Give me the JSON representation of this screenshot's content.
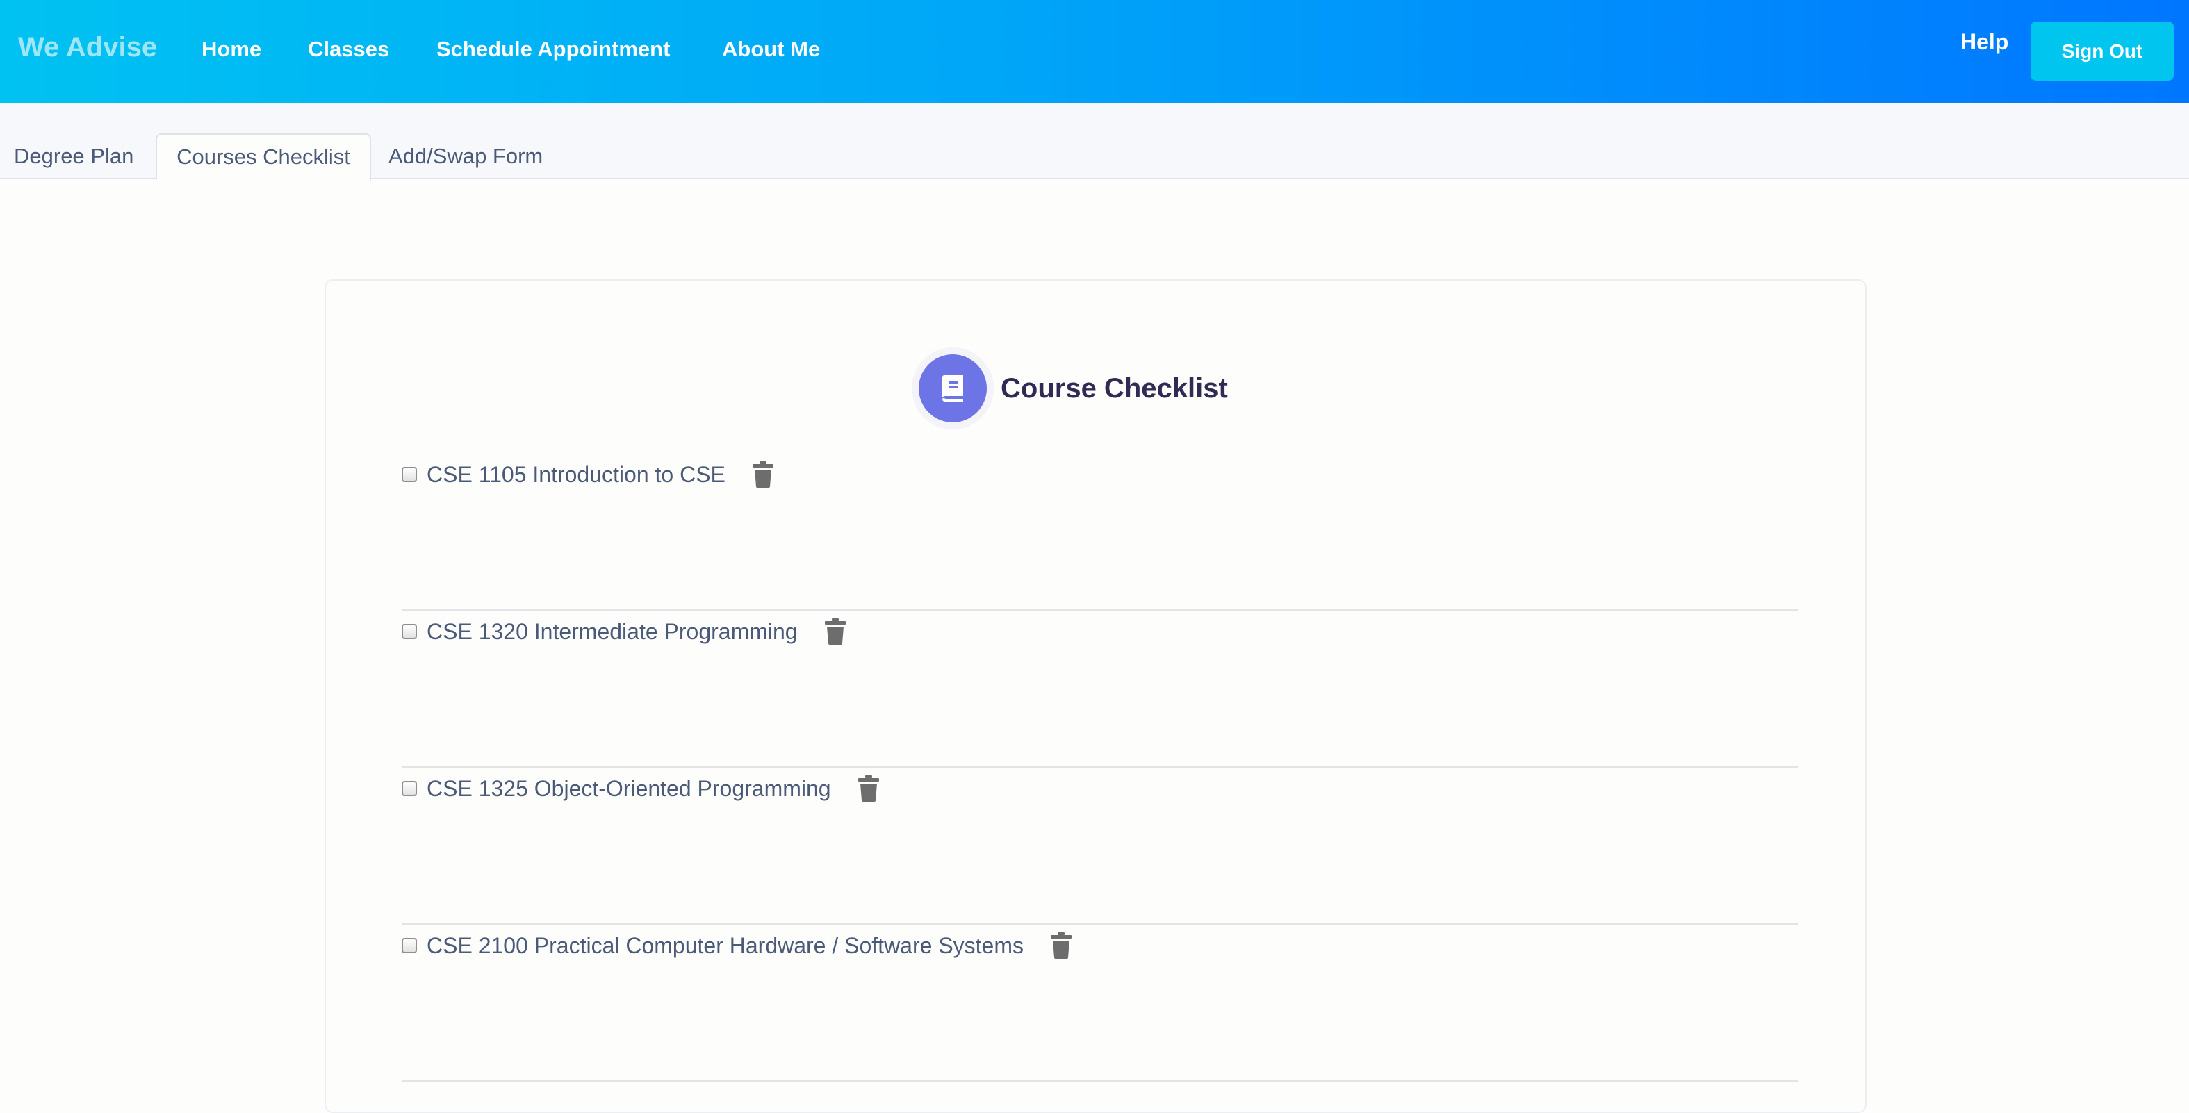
{
  "header": {
    "brand": "We Advise",
    "nav": {
      "home": "Home",
      "classes": "Classes",
      "schedule": "Schedule Appointment",
      "about": "About Me"
    },
    "help": "Help",
    "sign_out": "Sign Out"
  },
  "tabs": {
    "degree_plan": "Degree Plan",
    "courses_checklist": "Courses Checklist",
    "add_swap": "Add/Swap Form",
    "active": "Courses Checklist"
  },
  "checklist": {
    "title": "Course Checklist",
    "icon": "book-icon",
    "courses": [
      {
        "label": "CSE 1105 Introduction to CSE",
        "checked": false
      },
      {
        "label": "CSE 1320 Intermediate Programming",
        "checked": false
      },
      {
        "label": "CSE 1325 Object-Oriented Programming",
        "checked": false
      },
      {
        "label": "CSE 2100 Practical Computer Hardware / Software Systems",
        "checked": false
      }
    ]
  },
  "colors": {
    "nav_gradient_start": "#00c2f2",
    "nav_gradient_end": "#0076ff",
    "sign_out_bg": "#00c5ee",
    "icon_circle": "#6c74e6",
    "title_text": "#2f2b54",
    "body_text": "#4a5a78",
    "trash_icon": "#6d6d6d"
  }
}
